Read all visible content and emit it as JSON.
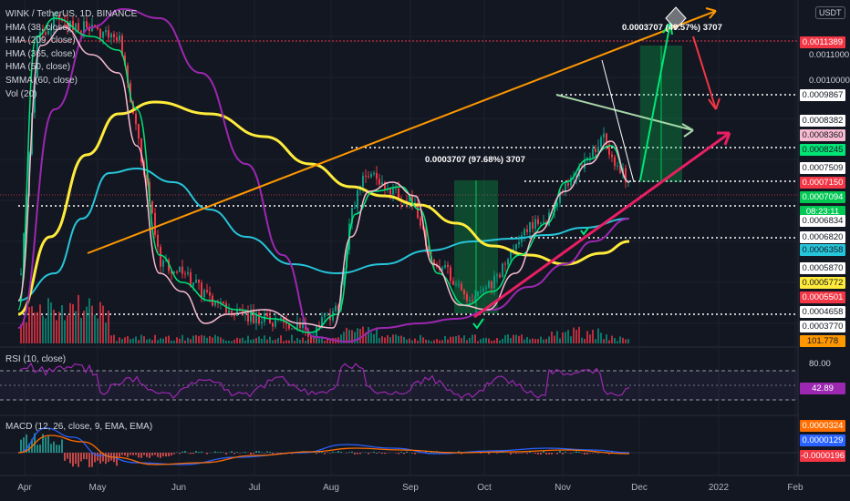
{
  "legend": {
    "symbol": "WINK / TetherUS, 1D, BINANCE",
    "indicators": [
      "HMA (38, close)",
      "HMA (209, close)",
      "HMA (365, close)",
      "HMA (50, close)",
      "SMMA (60, close)",
      "Vol (20)"
    ]
  },
  "currency_badge": "USDT",
  "rsi_title": "RSI (10, close)",
  "macd_title": "MACD (12, 26, close, 9, EMA, EMA)",
  "annotations": {
    "range_1": "0.0003707 (97.68%) 3707",
    "range_2": "0.0003707 (49.57%) 3707"
  },
  "price_axis_labels": {
    "top": "0.0011000",
    "second": "0.0010000"
  },
  "price_tags": [
    {
      "text": "0.0011389",
      "bg": "#f23645",
      "fg": "#ffffff"
    },
    {
      "text": "0.0009867",
      "bg": "#ffffff",
      "fg": "#131722"
    },
    {
      "text": "0.0008382",
      "bg": "#ffffff",
      "fg": "#131722"
    },
    {
      "text": "0.0008360",
      "bg": "#f8bbd0",
      "fg": "#131722"
    },
    {
      "text": "0.0008245",
      "bg": "#00e676",
      "fg": "#131722"
    },
    {
      "text": "0.0007509",
      "bg": "#ffffff",
      "fg": "#131722"
    },
    {
      "text": "0.0007150",
      "bg": "#f23645",
      "fg": "#ffffff"
    },
    {
      "text": "0.0007094",
      "bg": "#00c853",
      "fg": "#ffffff"
    },
    {
      "text": "08:23:11",
      "bg": "#00c853",
      "fg": "#ffffff"
    },
    {
      "text": "0.0006834",
      "bg": "#ffffff",
      "fg": "#131722"
    },
    {
      "text": "0.0006820",
      "bg": "#ffffff",
      "fg": "#131722"
    },
    {
      "text": "0.0006358",
      "bg": "#26c6da",
      "fg": "#131722"
    },
    {
      "text": "0.0005870",
      "bg": "#ffffff",
      "fg": "#131722"
    },
    {
      "text": "0.0005772",
      "bg": "#ffeb3b",
      "fg": "#131722"
    },
    {
      "text": "0.0005501",
      "bg": "#f23645",
      "fg": "#ffffff"
    },
    {
      "text": "0.0004658",
      "bg": "#ffffff",
      "fg": "#131722"
    },
    {
      "text": "0.0003770",
      "bg": "#ffffff",
      "fg": "#131722"
    },
    {
      "text": "101.778",
      "bg": "#ff9800",
      "fg": "#131722"
    }
  ],
  "rsi_axis": {
    "upper": "80.00",
    "value": "42.89",
    "value_color": "#9c27b0"
  },
  "macd_axis": [
    {
      "text": "0.0000324",
      "bg": "#ff6d00",
      "fg": "#ffffff"
    },
    {
      "text": "0.0000129",
      "bg": "#2962ff",
      "fg": "#ffffff"
    },
    {
      "text": "-0.0000196",
      "bg": "#f23645",
      "fg": "#ffffff"
    }
  ],
  "x_axis": [
    "Apr",
    "May",
    "Jun",
    "Jul",
    "Aug",
    "Sep",
    "Oct",
    "Nov",
    "Dec",
    "2022",
    "Feb"
  ],
  "chart_data": {
    "type": "line",
    "title": "WINK / TetherUS, 1D, BINANCE",
    "x_range": [
      "Apr",
      "Feb"
    ],
    "ylim": [
      0.00034,
      0.00125
    ],
    "grid": true,
    "legend_placement": "top-left",
    "series": [
      {
        "name": "WINK / TetherUS",
        "type": "candlestick",
        "x": [
          "Apr",
          "May",
          "Jun",
          "Jul",
          "Aug",
          "Sep",
          "Oct",
          "Nov",
          "Dec"
        ],
        "values": [
          0.00065,
          0.0012,
          0.0006,
          0.00042,
          0.00038,
          0.0008,
          0.0005,
          0.00078,
          0.00071
        ]
      },
      {
        "name": "HMA (38, close)",
        "color": "#00e676"
      },
      {
        "name": "HMA (209, close)",
        "color": "#9c27b0"
      },
      {
        "name": "HMA (365, close)",
        "color": "#ffeb3b"
      },
      {
        "name": "HMA (50, close)",
        "color": "#ffffff"
      },
      {
        "name": "SMMA (60, close)",
        "color": "#26c6da"
      },
      {
        "name": "Vol (20)",
        "color": "#ff9800"
      }
    ],
    "last_price": 0.0007094
  }
}
